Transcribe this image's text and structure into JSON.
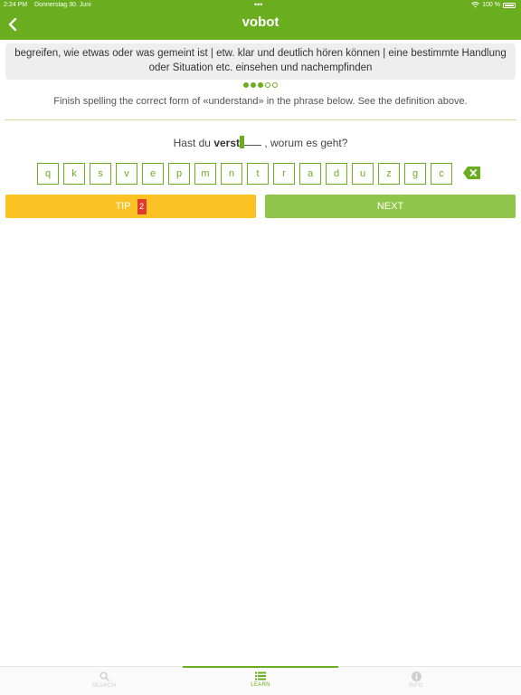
{
  "status_bar": {
    "time": "2:24 PM",
    "date": "Donnerstag 30. Juni",
    "battery": "100 %"
  },
  "header": {
    "title": "vobot"
  },
  "definition": "begreifen, wie etwas oder was gemeint ist | etw. klar und deutlich hören können | eine bestimmte Handlung oder Situation etc. einsehen und nachempfinden",
  "progress": {
    "current": 3,
    "total": 5
  },
  "instruction": "Finish spelling the correct form of «understand» in the phrase below. See the definition above.",
  "phrase": {
    "before": "Hast du ",
    "typed": "verst",
    "after": " , worum es geht?"
  },
  "letters": [
    "q",
    "k",
    "s",
    "v",
    "e",
    "p",
    "m",
    "n",
    "t",
    "r",
    "a",
    "d",
    "u",
    "z",
    "g",
    "c"
  ],
  "buttons": {
    "tip_label": "TIP",
    "tip_count": "2",
    "next_label": "NEXT"
  },
  "colors": {
    "brand": "#6aae1f",
    "tip": "#fcc223",
    "next": "#8fc64a",
    "badge": "#e3382f"
  },
  "tabs": [
    {
      "label": "SEARCH",
      "icon": "search-icon",
      "active": false
    },
    {
      "label": "LEARN",
      "icon": "list-icon",
      "active": true
    },
    {
      "label": "INFO",
      "icon": "info-icon",
      "active": false
    }
  ]
}
